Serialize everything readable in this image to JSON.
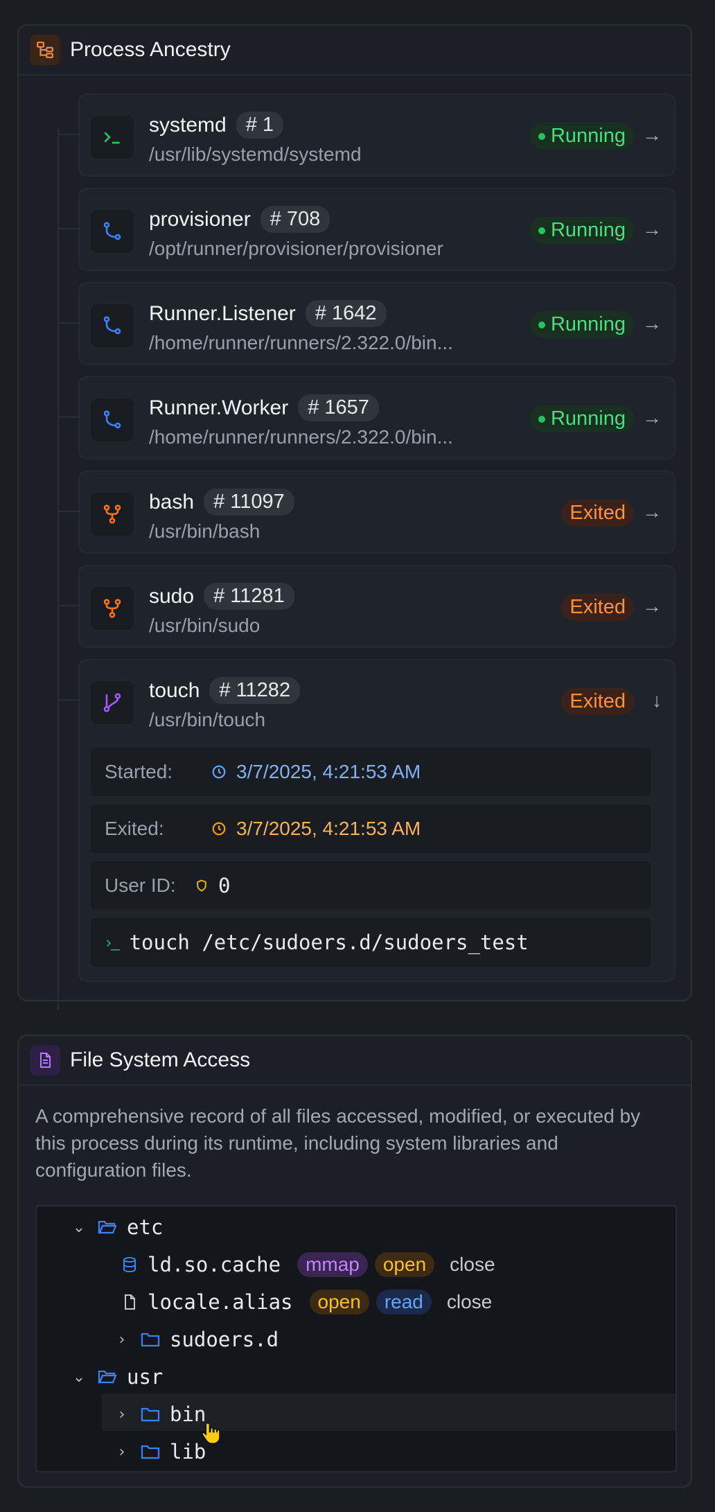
{
  "ancestry": {
    "title": "Process Ancestry",
    "processes": [
      {
        "name": "systemd",
        "pid": "# 1",
        "path": "/usr/lib/systemd/systemd",
        "status": "Running",
        "icon": "terminal-icon"
      },
      {
        "name": "provisioner",
        "pid": "# 708",
        "path": "/opt/runner/provisioner/provisioner",
        "status": "Running",
        "icon": "git-branch-icon"
      },
      {
        "name": "Runner.Listener",
        "pid": "# 1642",
        "path": "/home/runner/runners/2.322.0/bin...",
        "status": "Running",
        "icon": "git-branch-icon"
      },
      {
        "name": "Runner.Worker",
        "pid": "# 1657",
        "path": "/home/runner/runners/2.322.0/bin...",
        "status": "Running",
        "icon": "git-branch-icon"
      },
      {
        "name": "bash",
        "pid": "# 11097",
        "path": "/usr/bin/bash",
        "status": "Exited",
        "icon": "git-fork-icon"
      },
      {
        "name": "sudo",
        "pid": "# 11281",
        "path": "/usr/bin/sudo",
        "status": "Exited",
        "icon": "git-fork-icon"
      },
      {
        "name": "touch",
        "pid": "# 11282",
        "path": "/usr/bin/touch",
        "status": "Exited",
        "icon": "git-merge-icon"
      }
    ],
    "details": {
      "started_label": "Started:",
      "started_value": "3/7/2025, 4:21:53 AM",
      "exited_label": "Exited:",
      "exited_value": "3/7/2025, 4:21:53 AM",
      "user_label": "User ID:",
      "user_value": "0",
      "command": "touch /etc/sudoers.d/sudoers_test"
    }
  },
  "filesystem": {
    "title": "File System Access",
    "description": "A comprehensive record of all files accessed, modified, or executed by this process during its runtime, including system libraries and configuration files.",
    "tree": {
      "etc": "etc",
      "ld_so_cache": "ld.so.cache",
      "ld_so_cache_ops": [
        "mmap",
        "open",
        "close"
      ],
      "locale_alias": "locale.alias",
      "locale_alias_ops": [
        "open",
        "read",
        "close"
      ],
      "sudoers_d": "sudoers.d",
      "usr": "usr",
      "bin": "bin",
      "lib": "lib"
    }
  },
  "colors": {
    "running": "#4ade80",
    "exited": "#fb923c",
    "started_time": "#7fb2f0",
    "exited_time": "#f5b25a"
  }
}
